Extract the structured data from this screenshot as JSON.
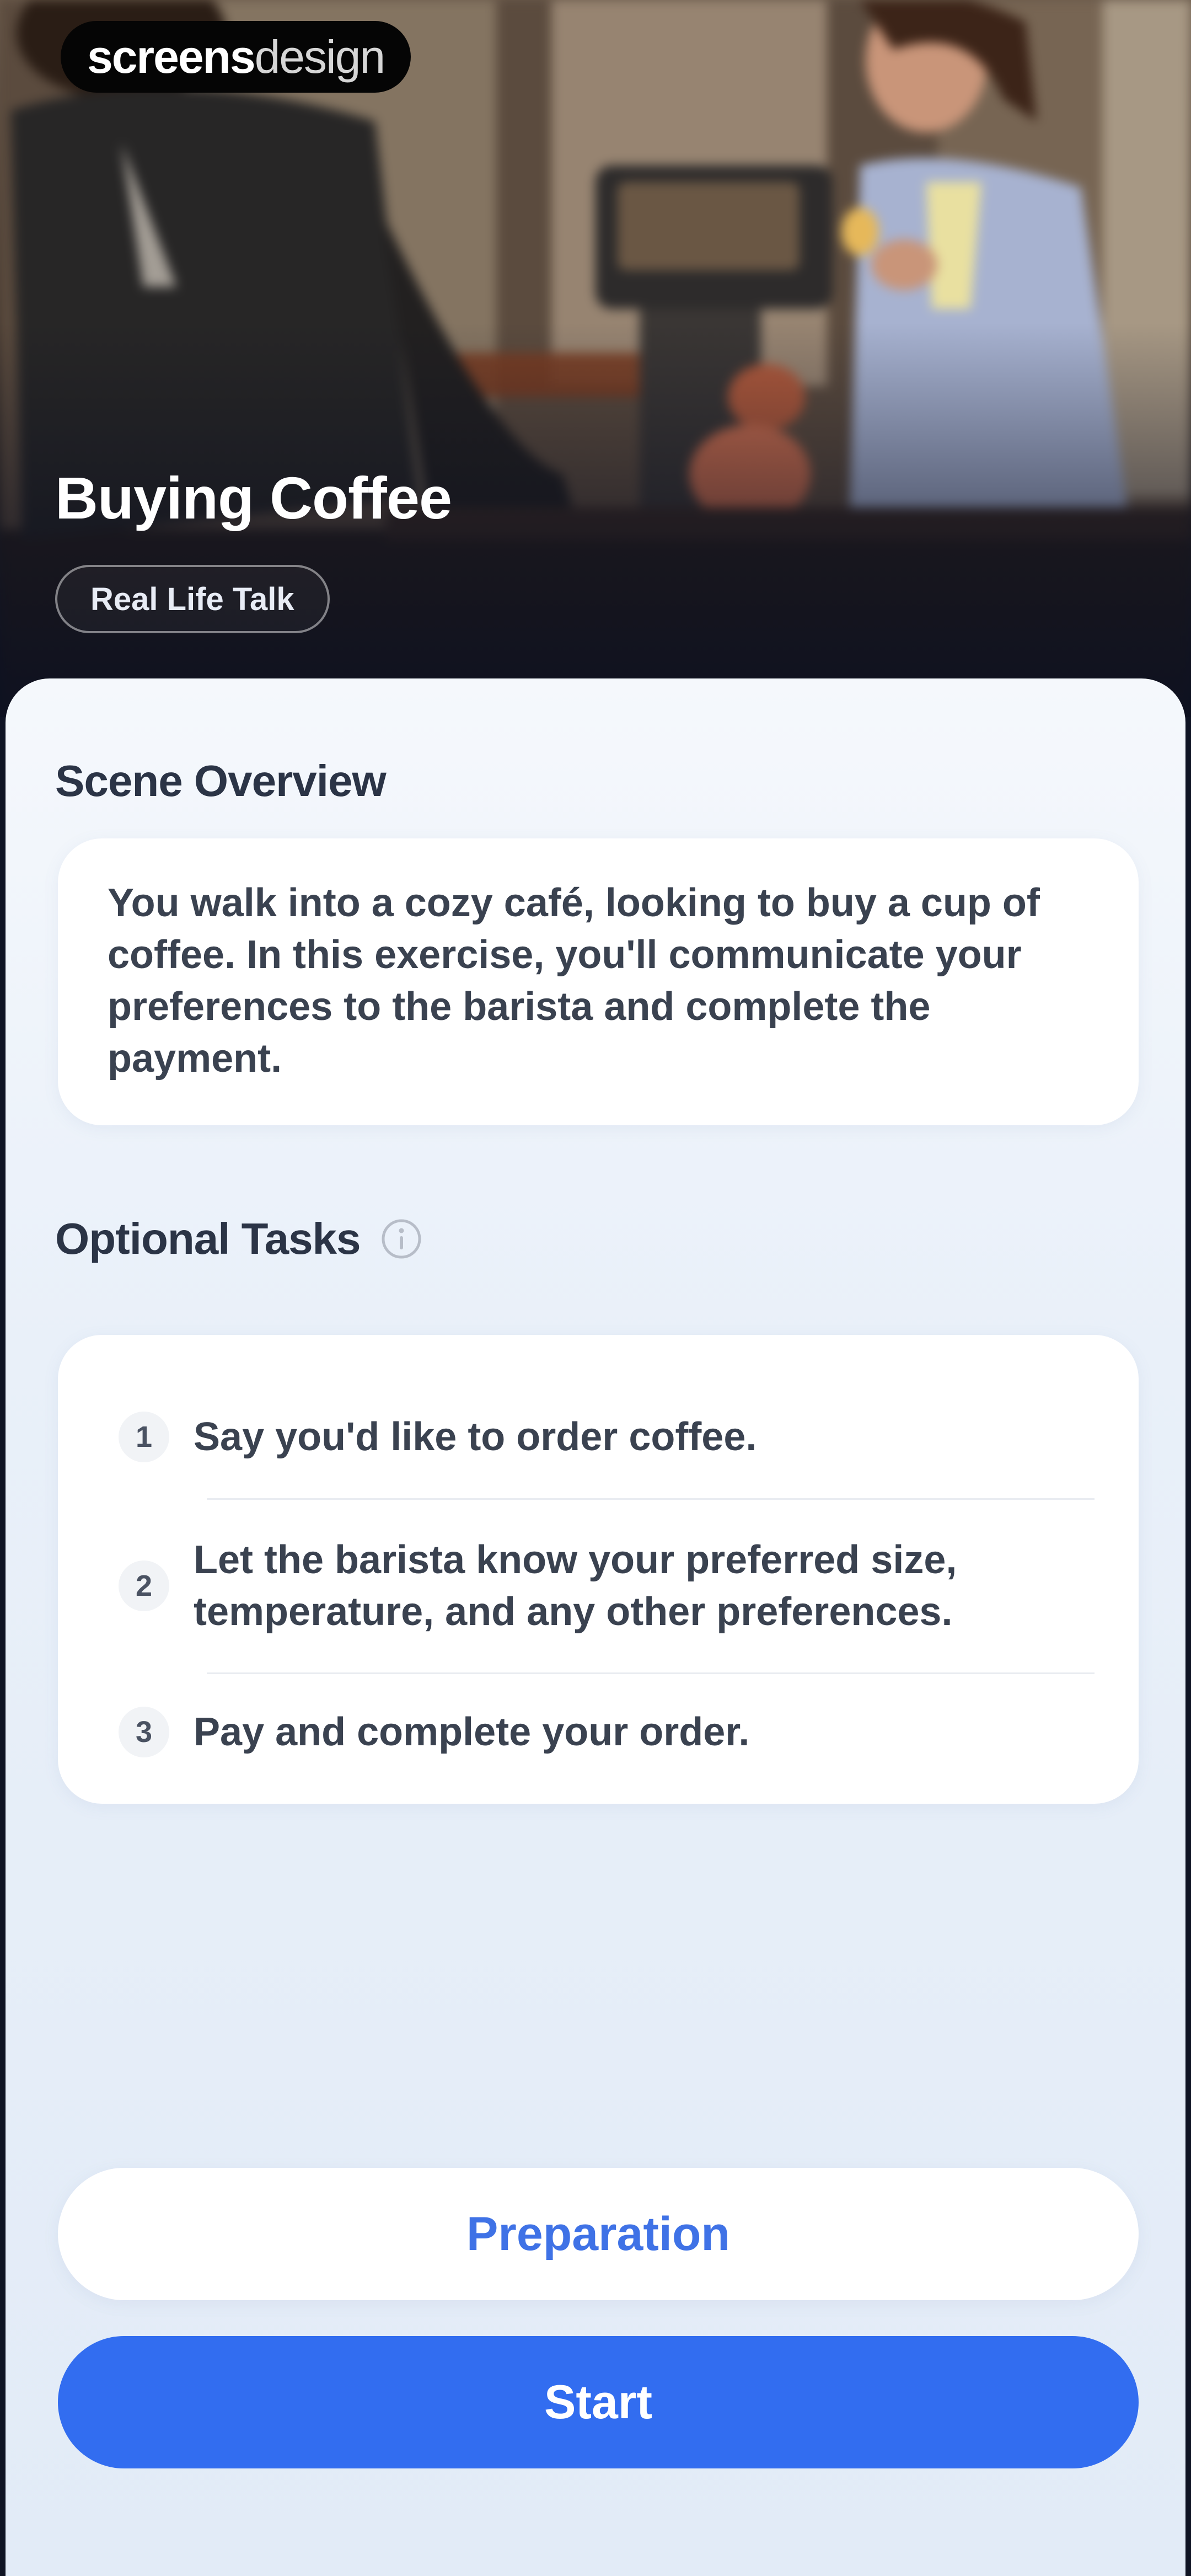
{
  "brand": {
    "name_strong": "screens",
    "name_light": "design"
  },
  "lesson": {
    "title": "Buying Coffee",
    "tag": "Real Life Talk"
  },
  "overview": {
    "heading": "Scene Overview",
    "text": "You walk into a cozy café, looking to buy a cup of coffee. In this exercise, you'll communicate your preferences to the barista and complete the payment."
  },
  "tasks": {
    "heading": "Optional Tasks",
    "info_icon": "info-icon",
    "items": [
      {
        "number": "1",
        "text": "Say you'd like to order coffee."
      },
      {
        "number": "2",
        "text": "Let the barista know your preferred size, temperature, and any other preferences."
      },
      {
        "number": "3",
        "text": "Pay and complete your order."
      }
    ]
  },
  "actions": {
    "preparation_label": "Preparation",
    "start_label": "Start"
  },
  "colors": {
    "accent": "#326df0",
    "accent_text": "#3f72e6",
    "sheet_background": "#e9f0f9",
    "heading_text": "#2b3446"
  }
}
